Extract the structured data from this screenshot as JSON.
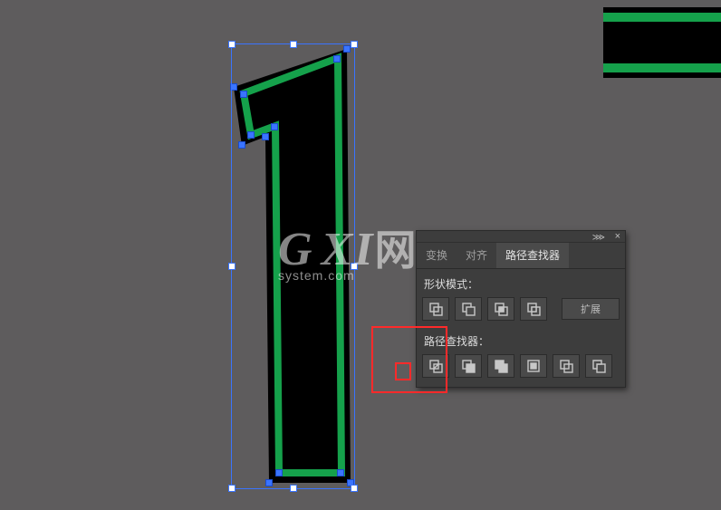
{
  "swatch": {
    "fill": "#000000",
    "stroke": "#15a14b"
  },
  "watermark": {
    "text": "GXI网",
    "sub": "system.com"
  },
  "panel": {
    "tabs": {
      "transform": "变换",
      "align": "对齐",
      "pathfinder": "路径查找器"
    },
    "active_tab": "pathfinder",
    "shape_modes_label": "形状模式：",
    "expand_label": "扩展",
    "pathfinders_label": "路径查找器：",
    "shape_modes": [
      {
        "name": "unite-icon"
      },
      {
        "name": "minus-front-icon"
      },
      {
        "name": "intersect-icon"
      },
      {
        "name": "exclude-icon"
      }
    ],
    "pathfinders": [
      {
        "name": "divide-icon"
      },
      {
        "name": "trim-icon"
      },
      {
        "name": "merge-icon"
      },
      {
        "name": "crop-icon"
      },
      {
        "name": "outline-icon"
      },
      {
        "name": "minus-back-icon"
      }
    ],
    "menu_glyph": "⋙",
    "close_glyph": "×"
  },
  "artwork": {
    "description": "Numeral 1 shape, black fill with green offset inner stroke, selected with bounding box and anchor points",
    "fill": "#000000",
    "inner_stroke": "#15a14b"
  }
}
